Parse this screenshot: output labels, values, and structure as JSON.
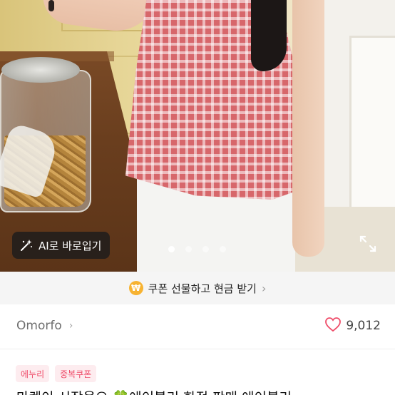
{
  "product_image": {
    "ai_button_label": "AI로 바로입기",
    "ai_icon": "magic-wand-icon",
    "carousel": {
      "total": 4,
      "active_index": 0
    },
    "expand_icon": "expand-icon"
  },
  "coupon_banner": {
    "badge_symbol": "₩",
    "text": "쿠폰 선물하고 현금 받기",
    "chevron": "›",
    "badge_color": "#f7b332"
  },
  "seller": {
    "name": "Omorfo",
    "chevron": "›"
  },
  "likes": {
    "icon": "heart-outline-icon",
    "count": "9,012",
    "icon_color": "#ef4d6a"
  },
  "tags": [
    {
      "label": "에누리"
    },
    {
      "label": "중복쿠폰"
    }
  ],
  "title": {
    "text": "마켓이 시작을요 🍀에이블리 한정 판매 에이블리"
  },
  "colors": {
    "tag_bg": "#fdecef",
    "tag_text": "#ef4d6a",
    "banner_bg": "#f5f5f5"
  }
}
